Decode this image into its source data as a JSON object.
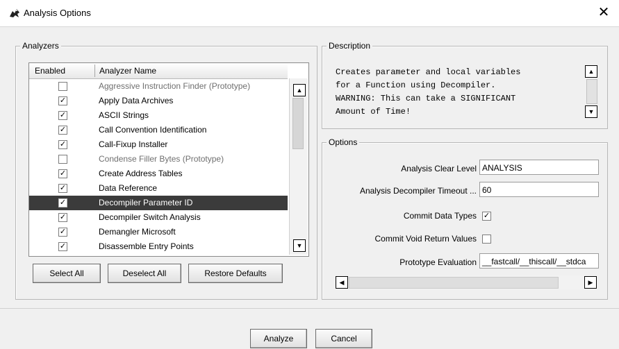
{
  "window": {
    "title": "Analysis Options",
    "close_glyph": "✕"
  },
  "analyzers": {
    "legend": "Analyzers",
    "columns": [
      "Enabled",
      "Analyzer Name"
    ],
    "rows": [
      {
        "name": "Aggressive Instruction Finder (Prototype)",
        "checked": false,
        "dim": true,
        "selected": false
      },
      {
        "name": "Apply Data Archives",
        "checked": true,
        "dim": false,
        "selected": false
      },
      {
        "name": "ASCII Strings",
        "checked": true,
        "dim": false,
        "selected": false
      },
      {
        "name": "Call Convention Identification",
        "checked": true,
        "dim": false,
        "selected": false
      },
      {
        "name": "Call-Fixup Installer",
        "checked": true,
        "dim": false,
        "selected": false
      },
      {
        "name": "Condense Filler Bytes (Prototype)",
        "checked": false,
        "dim": true,
        "selected": false
      },
      {
        "name": "Create Address Tables",
        "checked": true,
        "dim": false,
        "selected": false
      },
      {
        "name": "Data Reference",
        "checked": true,
        "dim": false,
        "selected": false
      },
      {
        "name": "Decompiler Parameter ID",
        "checked": true,
        "dim": false,
        "selected": true
      },
      {
        "name": "Decompiler Switch Analysis",
        "checked": true,
        "dim": false,
        "selected": false
      },
      {
        "name": "Demangler Microsoft",
        "checked": true,
        "dim": false,
        "selected": false
      },
      {
        "name": "Disassemble Entry Points",
        "checked": true,
        "dim": false,
        "selected": false
      }
    ],
    "buttons": {
      "select_all": "Select All",
      "deselect_all": "Deselect All",
      "restore_defaults": "Restore Defaults"
    }
  },
  "description": {
    "legend": "Description",
    "text": "Creates parameter and local variables\nfor a Function using Decompiler.\nWARNING: This can take a SIGNIFICANT\nAmount of Time!"
  },
  "options": {
    "legend": "Options",
    "analysis_clear_level": {
      "label": "Analysis Clear Level",
      "value": "ANALYSIS"
    },
    "decompiler_timeout": {
      "label": "Analysis Decompiler Timeout ...",
      "value": "60"
    },
    "commit_data_types": {
      "label": "Commit Data Types",
      "checked": true
    },
    "commit_void_return": {
      "label": "Commit Void Return Values",
      "checked": false
    },
    "prototype_evaluation": {
      "label": "Prototype Evaluation",
      "value": "__fastcall/__thiscall/__stdca"
    }
  },
  "footer": {
    "analyze": "Analyze",
    "cancel": "Cancel"
  },
  "glyphs": {
    "check": "✓",
    "up": "▲",
    "down": "▼",
    "left": "◀",
    "right": "▶"
  }
}
